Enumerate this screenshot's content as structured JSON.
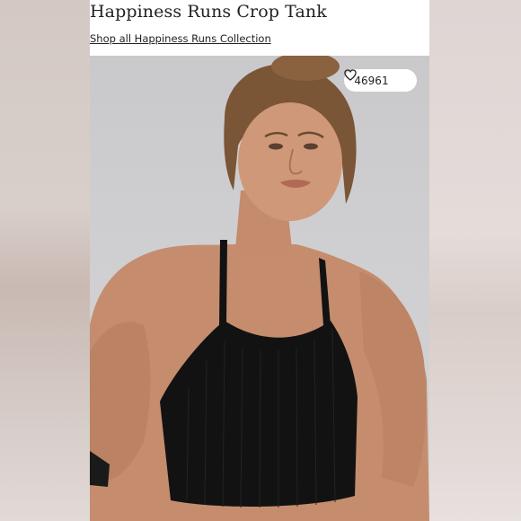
{
  "product": {
    "title": "Happiness Runs Crop Tank",
    "collection_link": "Shop all Happiness Runs Collection"
  },
  "image": {
    "like_count": "46961",
    "like_icon": "heart-outline-icon"
  },
  "colors": {
    "panel_bg": "#ffffff",
    "text": "#222222",
    "tank": "#121212",
    "photo_bg": "#cfcfd1"
  }
}
